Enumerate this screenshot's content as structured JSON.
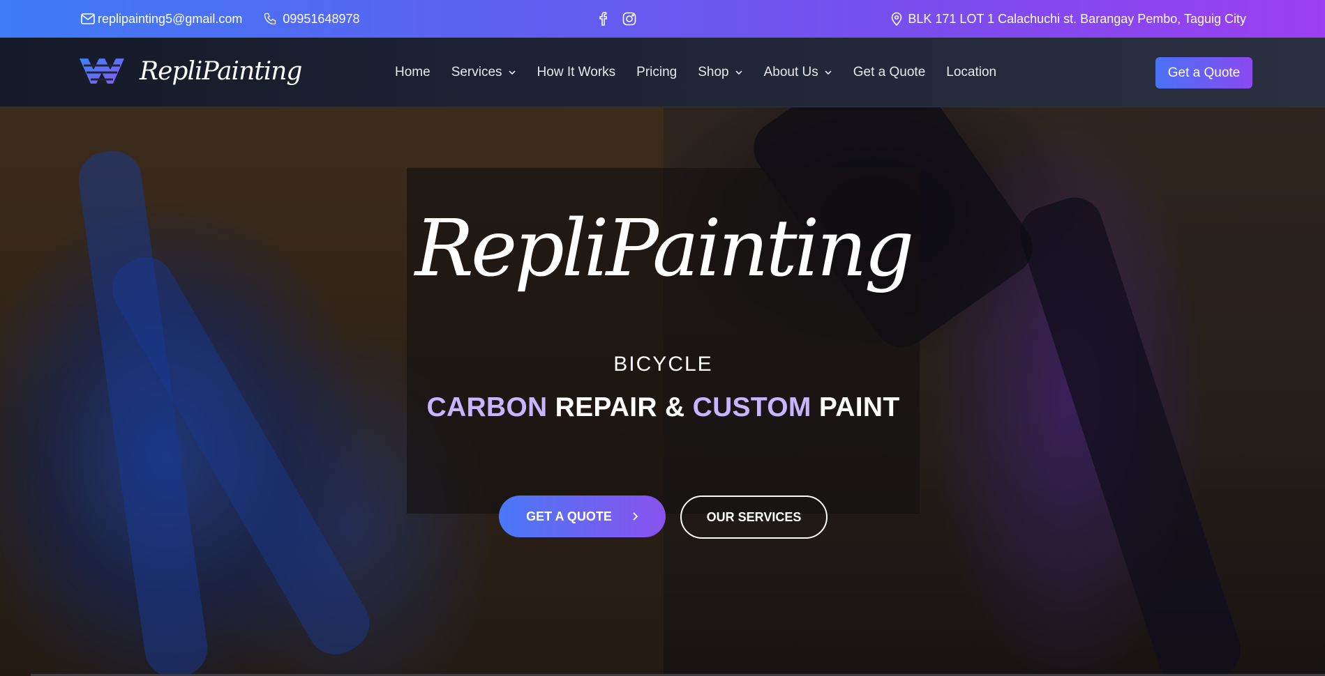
{
  "topbar": {
    "email": "replipainting5@gmail.com",
    "phone": "09951648978",
    "address": "BLK 171 LOT 1 Calachuchi st. Barangay Pembo, Taguig City",
    "icons": [
      "mail-icon",
      "phone-icon",
      "facebook-icon",
      "instagram-icon",
      "map-pin-icon"
    ]
  },
  "brand": {
    "name": "RepliPainting"
  },
  "nav": {
    "items": [
      {
        "label": "Home",
        "dropdown": false
      },
      {
        "label": "Services",
        "dropdown": true
      },
      {
        "label": "How It Works",
        "dropdown": false
      },
      {
        "label": "Pricing",
        "dropdown": false
      },
      {
        "label": "Shop",
        "dropdown": true
      },
      {
        "label": "About Us",
        "dropdown": true
      },
      {
        "label": "Get a Quote",
        "dropdown": false
      },
      {
        "label": "Location",
        "dropdown": false
      }
    ],
    "cta_label": "Get a Quote"
  },
  "hero": {
    "logo_text": "RepliPainting",
    "kicker": "BICYCLE",
    "headline": {
      "part1": "CARBON",
      "part2": " REPAIR & ",
      "part3": "CUSTOM",
      "part4": " PAINT"
    },
    "primary_button": "GET A QUOTE",
    "secondary_button": "OUR SERVICES"
  },
  "colors": {
    "topbar_start": "#3f7cf6",
    "topbar_end": "#9b3ff0",
    "accent_text": "#c6b6ff",
    "navbar_bg": "#1f2535"
  }
}
